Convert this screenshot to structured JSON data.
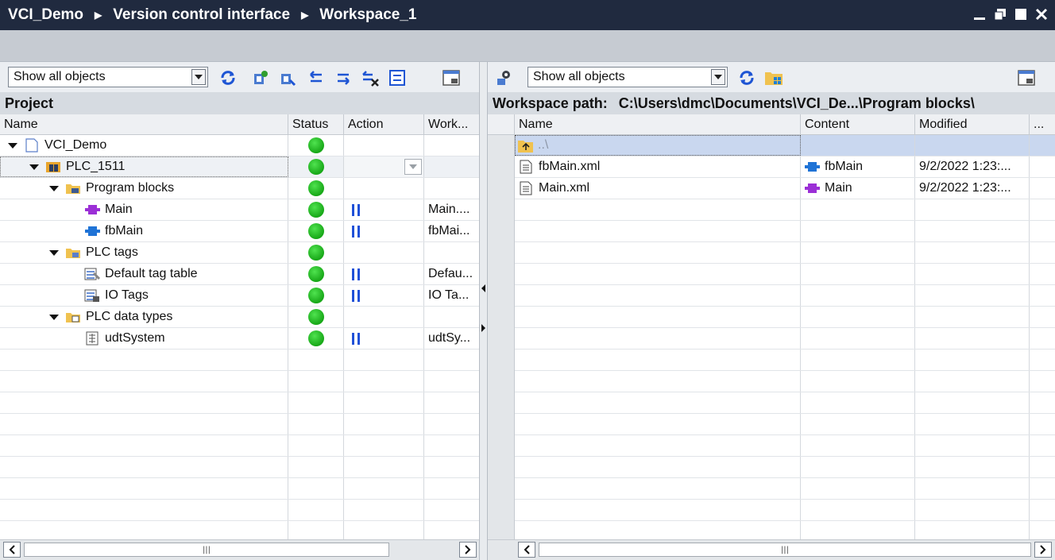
{
  "titlebar": {
    "crumbs": [
      "VCI_Demo",
      "Version control interface",
      "Workspace_1"
    ]
  },
  "left": {
    "filter": "Show all objects",
    "section_title": "Project",
    "columns": [
      "Name",
      "Status",
      "Action",
      "Work..."
    ],
    "rows": [
      {
        "name": "VCI_Demo",
        "workspace": ""
      },
      {
        "name": "PLC_1511",
        "workspace": ""
      },
      {
        "name": "Program blocks",
        "workspace": ""
      },
      {
        "name": "Main",
        "workspace": "Main...."
      },
      {
        "name": "fbMain",
        "workspace": "fbMai..."
      },
      {
        "name": "PLC tags",
        "workspace": ""
      },
      {
        "name": "Default tag table",
        "workspace": "Defau..."
      },
      {
        "name": "IO Tags",
        "workspace": "IO Ta..."
      },
      {
        "name": "PLC data types",
        "workspace": ""
      },
      {
        "name": "udtSystem",
        "workspace": "udtSy..."
      }
    ]
  },
  "right": {
    "filter": "Show all objects",
    "workspace_label": "Workspace path:",
    "workspace_path": "C:\\Users\\dmc\\Documents\\VCI_De...\\Program blocks\\",
    "columns": [
      "Name",
      "Content",
      "Modified",
      "..."
    ],
    "parent_row": "..\\",
    "rows": [
      {
        "name": "fbMain.xml",
        "content": "fbMain",
        "modified": "9/2/2022 1:23:..."
      },
      {
        "name": "Main.xml",
        "content": "Main",
        "modified": "9/2/2022 1:23:..."
      }
    ]
  },
  "colors": {
    "title_bg": "#202a3f",
    "status_green": "#18a818",
    "selection": "#c9d7ef"
  }
}
